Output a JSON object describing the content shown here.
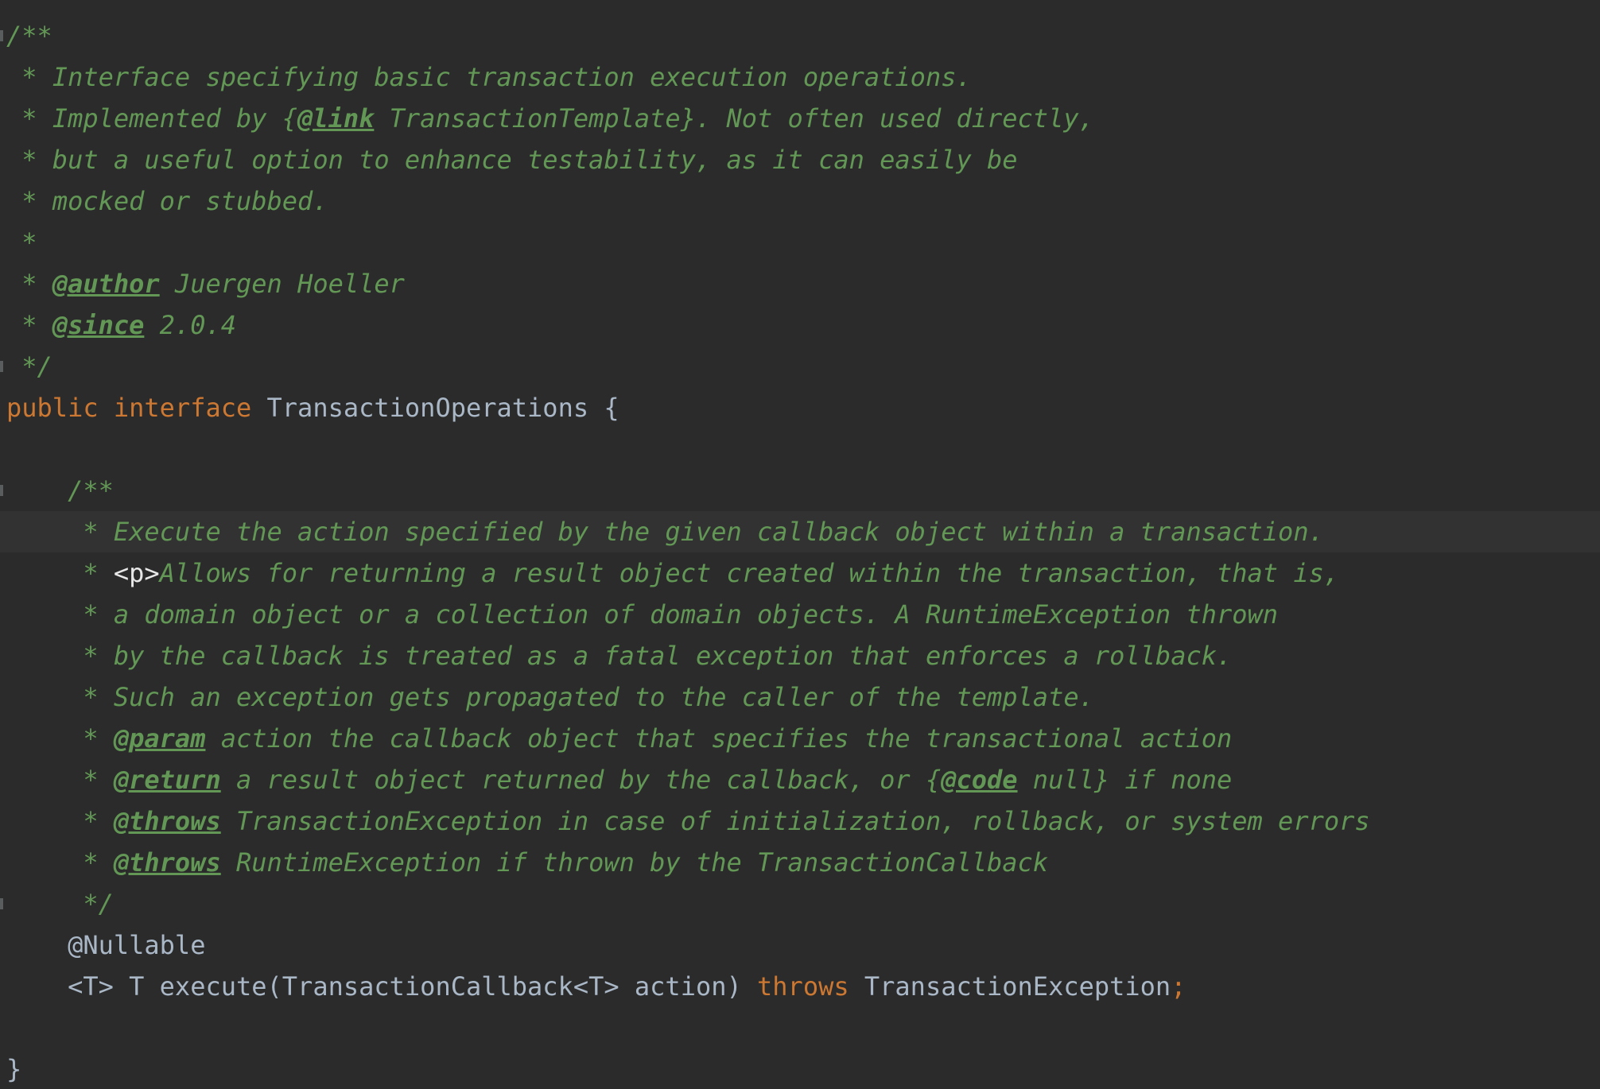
{
  "editor": {
    "lines": [
      {
        "tokens": [
          {
            "t": "/**",
            "c": "doc"
          }
        ],
        "fold": true
      },
      {
        "tokens": [
          {
            "t": " * Interface specifying basic transaction execution operations.",
            "c": "doc"
          }
        ]
      },
      {
        "tokens": [
          {
            "t": " * Implemented by {",
            "c": "doc"
          },
          {
            "t": "@link",
            "c": "doctag"
          },
          {
            "t": " TransactionTemplate}. Not often used directly,",
            "c": "doc"
          }
        ]
      },
      {
        "tokens": [
          {
            "t": " * but a useful option to enhance testability, as it can easily be",
            "c": "doc"
          }
        ]
      },
      {
        "tokens": [
          {
            "t": " * mocked or stubbed.",
            "c": "doc"
          }
        ]
      },
      {
        "tokens": [
          {
            "t": " *",
            "c": "doc"
          }
        ]
      },
      {
        "tokens": [
          {
            "t": " * ",
            "c": "doc"
          },
          {
            "t": "@author",
            "c": "doctag"
          },
          {
            "t": " Juergen Hoeller",
            "c": "doc"
          }
        ]
      },
      {
        "tokens": [
          {
            "t": " * ",
            "c": "doc"
          },
          {
            "t": "@since",
            "c": "doctag"
          },
          {
            "t": " 2.0.4",
            "c": "doc"
          }
        ]
      },
      {
        "tokens": [
          {
            "t": " */",
            "c": "doc"
          }
        ],
        "fold": true
      },
      {
        "tokens": [
          {
            "t": "public ",
            "c": "kw"
          },
          {
            "t": "interface ",
            "c": "kw"
          },
          {
            "t": "TransactionOperations {",
            "c": "plain"
          }
        ]
      },
      {
        "tokens": []
      },
      {
        "tokens": [
          {
            "t": "    /**",
            "c": "doc"
          }
        ],
        "fold": true
      },
      {
        "tokens": [
          {
            "t": "     * Execute the action specified by the given callback object within a transaction.",
            "c": "doc"
          }
        ],
        "current": true
      },
      {
        "tokens": [
          {
            "t": "     * ",
            "c": "doc"
          },
          {
            "t": "<p>",
            "c": "htmltag"
          },
          {
            "t": "Allows for returning a result object created within the transaction, that is,",
            "c": "doc"
          }
        ]
      },
      {
        "tokens": [
          {
            "t": "     * a domain object or a collection of domain objects. A RuntimeException thrown",
            "c": "doc"
          }
        ]
      },
      {
        "tokens": [
          {
            "t": "     * by the callback is treated as a fatal exception that enforces a rollback.",
            "c": "doc"
          }
        ]
      },
      {
        "tokens": [
          {
            "t": "     * Such an exception gets propagated to the caller of the template.",
            "c": "doc"
          }
        ]
      },
      {
        "tokens": [
          {
            "t": "     * ",
            "c": "doc"
          },
          {
            "t": "@param",
            "c": "doctag"
          },
          {
            "t": " action the callback object that specifies the transactional action",
            "c": "doc"
          }
        ]
      },
      {
        "tokens": [
          {
            "t": "     * ",
            "c": "doc"
          },
          {
            "t": "@return",
            "c": "doctag"
          },
          {
            "t": " a result object returned by the callback, or {",
            "c": "doc"
          },
          {
            "t": "@code",
            "c": "doctag"
          },
          {
            "t": " null} if none",
            "c": "doc"
          }
        ]
      },
      {
        "tokens": [
          {
            "t": "     * ",
            "c": "doc"
          },
          {
            "t": "@throws",
            "c": "doctag"
          },
          {
            "t": " TransactionException in case of initialization, rollback, or system errors",
            "c": "doc"
          }
        ]
      },
      {
        "tokens": [
          {
            "t": "     * ",
            "c": "doc"
          },
          {
            "t": "@throws",
            "c": "doctag"
          },
          {
            "t": " RuntimeException if thrown by the TransactionCallback",
            "c": "doc"
          }
        ]
      },
      {
        "tokens": [
          {
            "t": "     */",
            "c": "doc"
          }
        ],
        "fold": true
      },
      {
        "tokens": [
          {
            "t": "    @Nullable",
            "c": "plain"
          }
        ]
      },
      {
        "tokens": [
          {
            "t": "    <T> T execute(TransactionCallback<T> action) ",
            "c": "plain"
          },
          {
            "t": "throws ",
            "c": "kw"
          },
          {
            "t": "TransactionException",
            "c": "plain"
          },
          {
            "t": ";",
            "c": "semi"
          }
        ]
      },
      {
        "tokens": []
      },
      {
        "tokens": [
          {
            "t": "}",
            "c": "plain"
          }
        ]
      }
    ]
  }
}
